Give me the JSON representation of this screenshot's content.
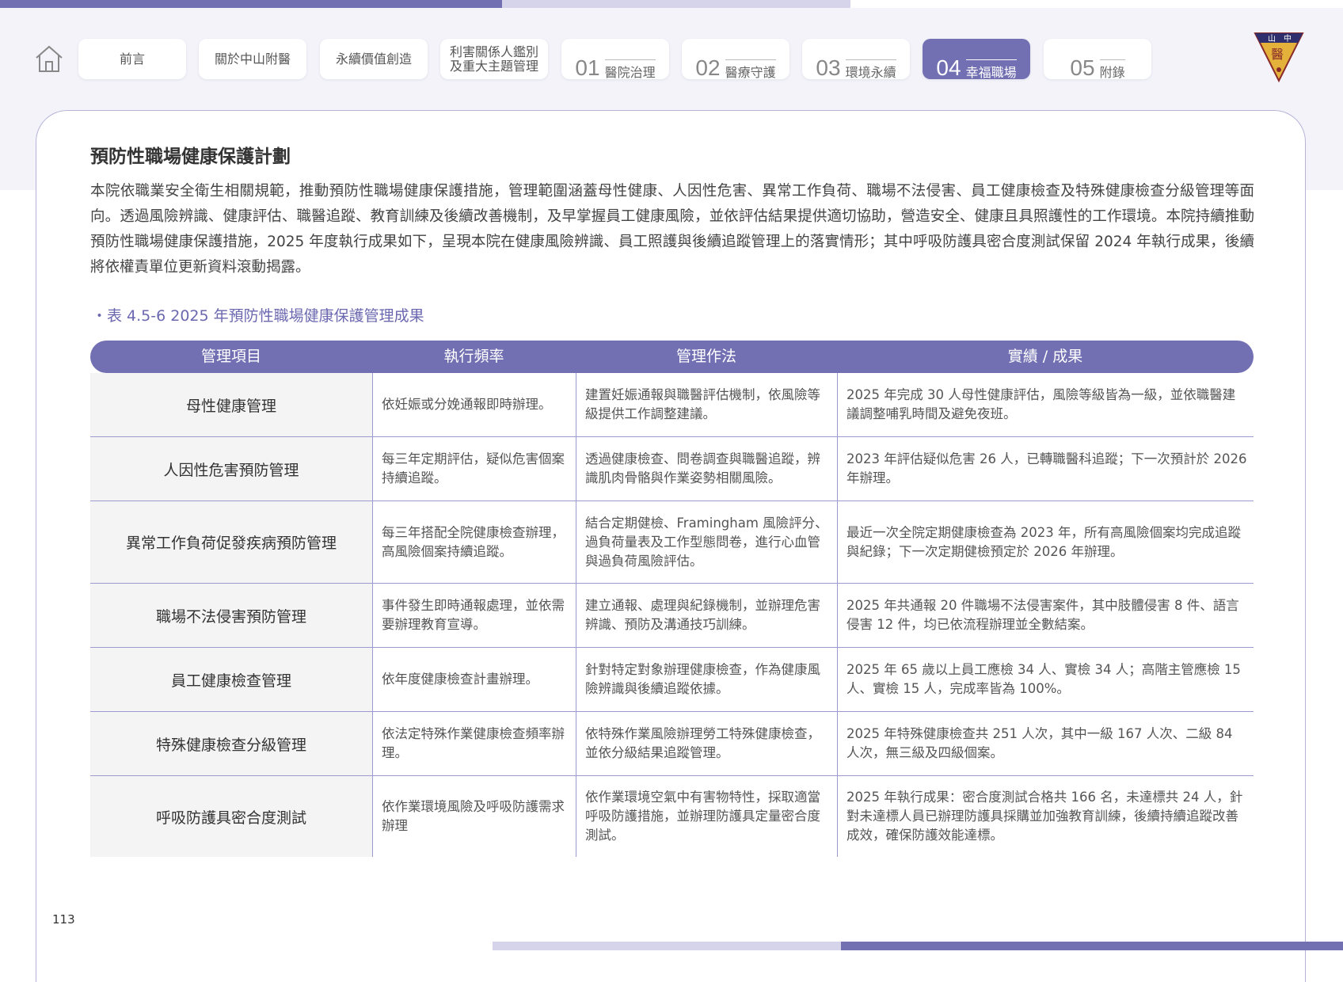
{
  "nav": {
    "home_icon": "home-icon",
    "items": [
      {
        "label": "前言"
      },
      {
        "label": "關於中山附醫"
      },
      {
        "label": "永續價值創造"
      },
      {
        "label": "利害關係人鑑別\n及重大主題管理"
      }
    ],
    "chapters": [
      {
        "num": "01",
        "label": "醫院治理"
      },
      {
        "num": "02",
        "label": "醫療守護"
      },
      {
        "num": "03",
        "label": "環境永續"
      },
      {
        "num": "04",
        "label": "幸福職場"
      },
      {
        "num": "05",
        "label": "附錄"
      }
    ],
    "active_chapter": "04",
    "accent_color": "#7270b3"
  },
  "logo": {
    "text": "山中醫"
  },
  "section_title": "預防性職場健康保護計劃",
  "intro": "本院依職業安全衛生相關規範，推動預防性職場健康保護措施，管理範圍涵蓋母性健康、人因性危害、異常工作負荷、職場不法侵害、員工健康檢查及特殊健康檢查分級管理等面向。透過風險辨識、健康評估、職醫追蹤、教育訓練及後續改善機制，及早掌握員工健康風險，並依評估結果提供適切協助，營造安全、健康且具照護性的工作環境。本院持續推動預防性職場健康保護措施，2025 年度執行成果如下，呈現本院在健康風險辨識、員工照護與後續追蹤管理上的落實情形；其中呼吸防護具密合度測試保留 2024 年執行成果，後續將依權責單位更新資料滾動揭露。",
  "table": {
    "caption": "・表 4.5-6 2025 年預防性職場健康保護管理成果",
    "headers": [
      "管理項目",
      "執行頻率",
      "管理作法",
      "實績 / 成果"
    ],
    "rows": [
      {
        "item": "母性健康管理",
        "freq": "依妊娠或分娩通報即時辦理。",
        "method": "建置妊娠通報與職醫評估機制，依風險等級提供工作調整建議。",
        "result": "2025 年完成 30 人母性健康評估，風險等級皆為一級，並依職醫建議調整哺乳時間及避免夜班。"
      },
      {
        "item": "人因性危害預防管理",
        "freq": "每三年定期評估，疑似危害個案持續追蹤。",
        "method": "透過健康檢查、問卷調查與職醫追蹤，辨識肌肉骨骼與作業姿勢相關風險。",
        "result": "2023 年評估疑似危害 26 人，已轉職醫科追蹤；下一次預計於 2026 年辦理。"
      },
      {
        "item": "異常工作負荷促發疾病預防管理",
        "freq": "每三年搭配全院健康檢查辦理，高風險個案持續追蹤。",
        "method": "結合定期健檢、Framingham 風險評分、過負荷量表及工作型態問卷，進行心血管與過負荷風險評估。",
        "result": "最近一次全院定期健康檢查為 2023 年，所有高風險個案均完成追蹤與紀錄；下一次定期健檢預定於 2026 年辦理。"
      },
      {
        "item": "職場不法侵害預防管理",
        "freq": "事件發生即時通報處理，並依需要辦理教育宣導。",
        "method": "建立通報、處理與紀錄機制，並辦理危害辨識、預防及溝通技巧訓練。",
        "result": "2025 年共通報 20 件職場不法侵害案件，其中肢體侵害 8 件、語言侵害 12 件，均已依流程辦理並全數結案。"
      },
      {
        "item": "員工健康檢查管理",
        "freq": "依年度健康檢查計畫辦理。",
        "method": "針對特定對象辦理健康檢查，作為健康風險辨識與後續追蹤依據。",
        "result": "2025 年 65 歲以上員工應檢 34 人、實檢 34 人；高階主管應檢 15 人、實檢 15 人，完成率皆為 100%。"
      },
      {
        "item": "特殊健康檢查分級管理",
        "freq": "依法定特殊作業健康檢查頻率辦理。",
        "method": "依特殊作業風險辦理勞工特殊健康檢查，並依分級結果追蹤管理。",
        "result": "2025 年特殊健康檢查共 251 人次，其中一級 167 人次、二級 84 人次，無三級及四級個案。"
      },
      {
        "item": "呼吸防護具密合度測試",
        "freq": "依作業環境風險及呼吸防護需求辦理",
        "method": "依作業環境空氣中有害物特性，採取適當呼吸防護措施，並辦理防護具定量密合度測試。",
        "result": "2025 年執行成果：密合度測試合格共 166 名，未達標共 24 人，針對未達標人員已辦理防護具採購並加強教育訓練，後續持續追蹤改善成效，確保防護效能達標。"
      }
    ]
  },
  "page_number": "113"
}
